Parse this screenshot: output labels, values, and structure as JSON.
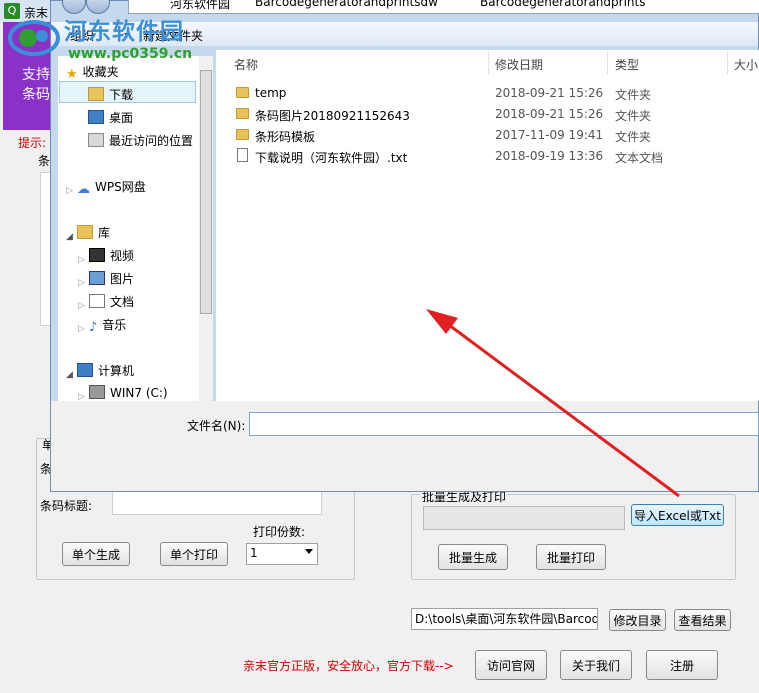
{
  "watermark": {
    "name": "河东软件园",
    "url": "www.pc0359.cn"
  },
  "app": {
    "title": "亲末",
    "banner_line1": "支持",
    "banner_line2": "条码",
    "hint": "提示:",
    "barcode_label_a": "条",
    "single_group_label": "单",
    "barcode_label_b": "条",
    "title_label": "条码标题:",
    "copies_label": "打印份数:",
    "single_generate": "单个生成",
    "single_print": "单个打印",
    "copies_value": "1",
    "batch_group_label": "批量生成及打印",
    "import_button": "导入Excel或Txt",
    "batch_generate": "批量生成",
    "batch_print": "批量打印",
    "output_path": "D:\\tools\\桌面\\河东软件园\\Barcode",
    "change_dir": "修改目录",
    "view_result": "查看结果",
    "promo": "亲末官方正版，安全放心，官方下载-->",
    "visit_site": "访问官网",
    "about_us": "关于我们",
    "register": "注册"
  },
  "dialog": {
    "breadcrumb": [
      "河东软件园",
      "Barcodegeneratorandprintsdw",
      "Barcodegeneratorandprints"
    ],
    "toolbar": {
      "organize": "组织",
      "new_folder": "新建文件夹"
    },
    "nav": {
      "favorites": "收藏夹",
      "downloads": "下载",
      "desktop": "桌面",
      "recent": "最近访问的位置",
      "wps": "WPS网盘",
      "library": "库",
      "video": "视频",
      "pictures": "图片",
      "documents": "文档",
      "music": "音乐",
      "computer": "计算机",
      "drive_c": "WIN7 (C:)"
    },
    "columns": {
      "name": "名称",
      "date": "修改日期",
      "type": "类型",
      "size": "大小"
    },
    "files": [
      {
        "name": "temp",
        "date": "2018-09-21 15:26",
        "type": "文件夹",
        "kind": "folder"
      },
      {
        "name": "条码图片20180921152643",
        "date": "2018-09-21 15:26",
        "type": "文件夹",
        "kind": "folder"
      },
      {
        "name": "条形码模板",
        "date": "2017-11-09 19:41",
        "type": "文件夹",
        "kind": "folder"
      },
      {
        "name": "下载说明（河东软件园）.txt",
        "date": "2018-09-19 13:36",
        "type": "文本文档",
        "kind": "text"
      }
    ],
    "filename_label": "文件名(N):",
    "filename_value": ""
  },
  "colors": {
    "arrow": "#e02020",
    "banner": "#8a32c8",
    "promo": "#cc0000",
    "watermark_blue": "#3a8fd6",
    "watermark_green": "#2fa02f"
  }
}
